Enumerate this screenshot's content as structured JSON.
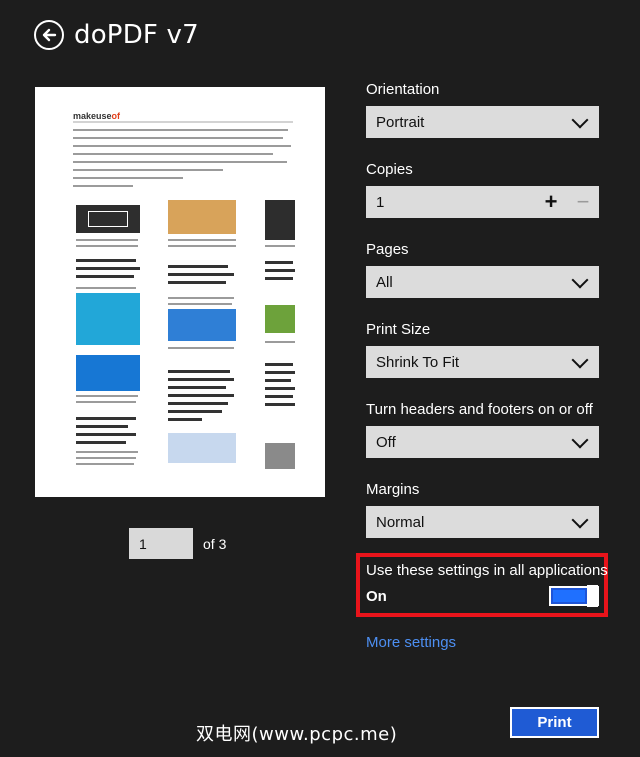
{
  "app": {
    "title": "doPDF v7"
  },
  "pager": {
    "current": "1",
    "of_text": "of 3"
  },
  "preview": {
    "logo_make": "makeuse",
    "logo_of": "of"
  },
  "settings": {
    "orientation": {
      "label": "Orientation",
      "value": "Portrait"
    },
    "copies": {
      "label": "Copies",
      "value": "1",
      "plus": "+",
      "minus": "−"
    },
    "pages": {
      "label": "Pages",
      "value": "All"
    },
    "print_size": {
      "label": "Print Size",
      "value": "Shrink To Fit"
    },
    "headers_footers": {
      "label": "Turn headers and footers on or off",
      "value": "Off"
    },
    "margins": {
      "label": "Margins",
      "value": "Normal"
    },
    "use_all": {
      "label": "Use these settings in all applications",
      "state": "On",
      "on": true
    },
    "more_settings": "More settings"
  },
  "actions": {
    "print": "Print"
  },
  "watermark": "双电网(www.pcpc.me)",
  "colors": {
    "accent": "#1f5bd4",
    "highlight": "#e8141b",
    "link": "#4d8ff2",
    "background": "#1d1d1d"
  }
}
